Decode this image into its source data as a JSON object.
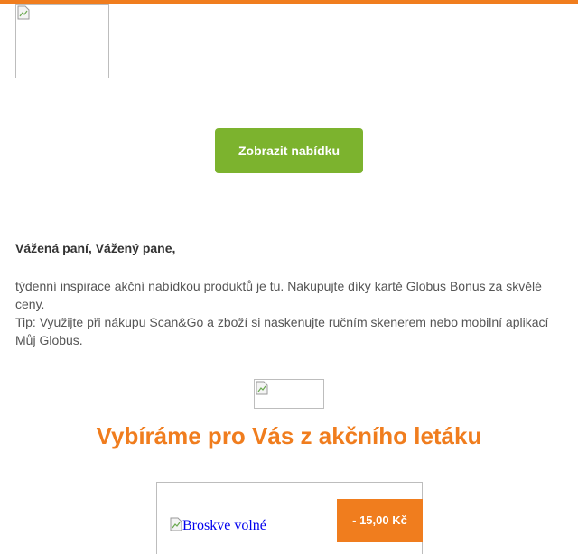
{
  "header": {
    "logo_icon": "broken-image-icon",
    "accent_color": "#f07d1e"
  },
  "cta": {
    "label": "Zobrazit nabídku",
    "color": "#7cb32e"
  },
  "letter": {
    "greeting": "Vážená paní, Vážený pane,",
    "paragraph_1": "týdenní inspirace akční nabídkou produktů je tu. Nakupujte díky kartě Globus Bonus za skvělé ceny.",
    "paragraph_2": "Tip: Využijte při nákupu Scan&Go a zboží si naskenujte ručním skenerem nebo mobilní aplikací Můj Globus."
  },
  "section": {
    "headline": "Vybíráme pro Vás z akčního letáku"
  },
  "product": {
    "name": "Broskve volné",
    "discount": "- 15,00 Kč"
  }
}
